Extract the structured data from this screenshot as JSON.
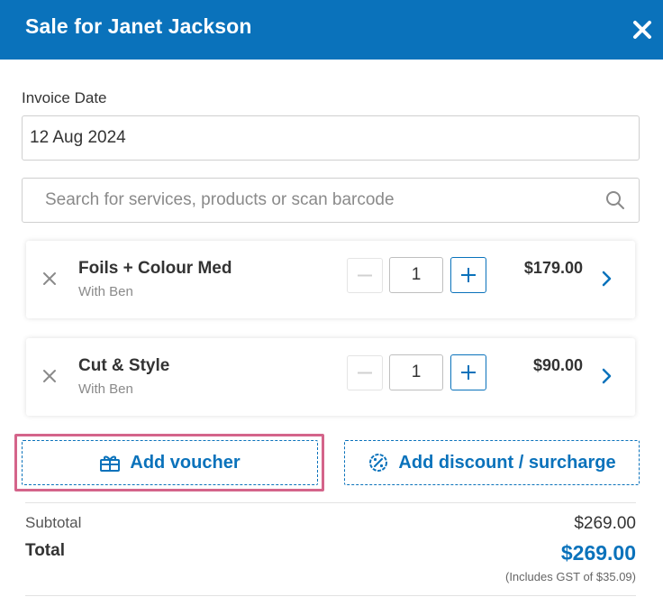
{
  "header": {
    "title": "Sale for Janet Jackson",
    "close_icon": "close-icon"
  },
  "invoice": {
    "label": "Invoice Date",
    "date": "12 Aug 2024"
  },
  "search": {
    "placeholder": "Search for services, products or scan barcode",
    "icon": "search-icon"
  },
  "items": [
    {
      "name": "Foils + Colour Med",
      "staff": "With Ben",
      "quantity": "1",
      "price": "$179.00"
    },
    {
      "name": "Cut & Style",
      "staff": "With Ben",
      "quantity": "1",
      "price": "$90.00"
    }
  ],
  "actions": {
    "voucher_label": "Add voucher",
    "discount_label": "Add discount / surcharge"
  },
  "totals": {
    "subtotal_label": "Subtotal",
    "subtotal": "$269.00",
    "total_label": "Total",
    "total": "$269.00",
    "gst_note": "(Includes GST of $35.09)"
  },
  "colors": {
    "brand": "#0a72bb",
    "highlight": "#d4648a"
  }
}
